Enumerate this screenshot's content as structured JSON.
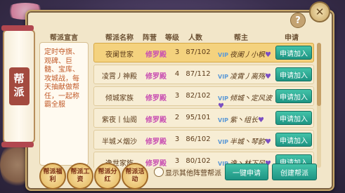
{
  "window": {
    "tab_label": "帮派",
    "help_label": "?",
    "close_label": "✕"
  },
  "slogan": {
    "title": "帮派宣言",
    "text": "定时夺旗、观碑、巨髓、宝库、攻城战，每天抽献做帮任，一起称霸全服"
  },
  "table": {
    "headers": {
      "name": "帮派名称",
      "camp": "阵营",
      "level": "等级",
      "count": "人数",
      "leader": "帮主",
      "apply": "申请"
    },
    "rows": [
      {
        "name": "夜阑世家",
        "camp": "修罗殿",
        "level": "3",
        "count": "87/102",
        "vip": "VIP",
        "leader": "夜阑丿小枫",
        "apply_label": "申请加入",
        "selected": true
      },
      {
        "name": "凌霄丿神殿",
        "camp": "修罗殿",
        "level": "4",
        "count": "87/112",
        "vip": "VIP",
        "leader": "凌霄丿离殇",
        "apply_label": "申请加入",
        "selected": false
      },
      {
        "name": "倾城家族",
        "camp": "修罗殿",
        "level": "3",
        "count": "82/102",
        "vip": "VIP",
        "leader": "倾城丶定风波",
        "apply_label": "申请加入",
        "selected": false
      },
      {
        "name": "紫夜丨仙阁",
        "camp": "修罗殿",
        "level": "2",
        "count": "95/101",
        "vip": "VIP",
        "leader": "紫丶组长",
        "apply_label": "申请加入",
        "selected": false
      },
      {
        "name": "半城メ烟沙",
        "camp": "修罗殿",
        "level": "3",
        "count": "86/102",
        "vip": "VIP",
        "leader": "半城丶琴韵",
        "apply_label": "申请加入",
        "selected": false
      },
      {
        "name": "逸世家族",
        "camp": "修罗殿",
        "level": "3",
        "count": "80/102",
        "vip": "VIP",
        "leader": "逸丶林下风",
        "apply_label": "申请加入",
        "selected": false
      }
    ]
  },
  "bottom": {
    "round_buttons": [
      "帮派福利",
      "帮派工资",
      "帮派分红",
      "帮派活动"
    ],
    "checkbox_label": "显示其他阵营帮派",
    "one_click_label": "一键申请",
    "create_label": "创建帮派"
  }
}
